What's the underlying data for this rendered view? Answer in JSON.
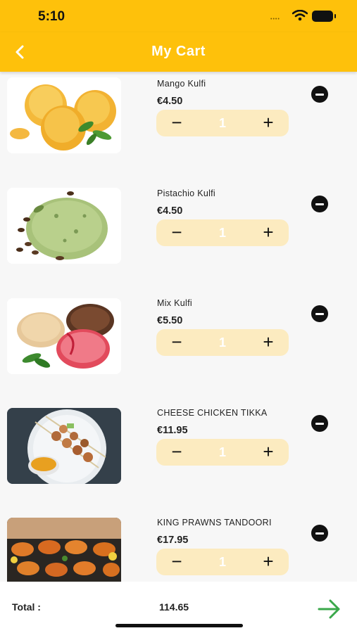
{
  "status_bar": {
    "time": "5:10"
  },
  "header": {
    "title": "My Cart",
    "back_icon": "chevron-left-icon"
  },
  "cart": {
    "items": [
      {
        "name": "Mango Kulfi",
        "price": "€4.50",
        "quantity": "1"
      },
      {
        "name": "Pistachio Kulfi",
        "price": "€4.50",
        "quantity": "1"
      },
      {
        "name": "Mix Kulfi",
        "price": "€5.50",
        "quantity": "1"
      },
      {
        "name": "CHEESE CHICKEN TIKKA",
        "price": "€11.95",
        "quantity": "1"
      },
      {
        "name": "KING PRAWNS TANDOORI",
        "price": "€17.95",
        "quantity": "1"
      }
    ],
    "stepper": {
      "minus_label": "−",
      "plus_label": "+"
    }
  },
  "footer": {
    "total_label": "Total :",
    "total_value": "114.65",
    "checkout_icon": "arrow-right-icon"
  },
  "colors": {
    "primary": "#fec10b",
    "stepper_bg": "#fcebc0",
    "checkout": "#3aa84a"
  }
}
